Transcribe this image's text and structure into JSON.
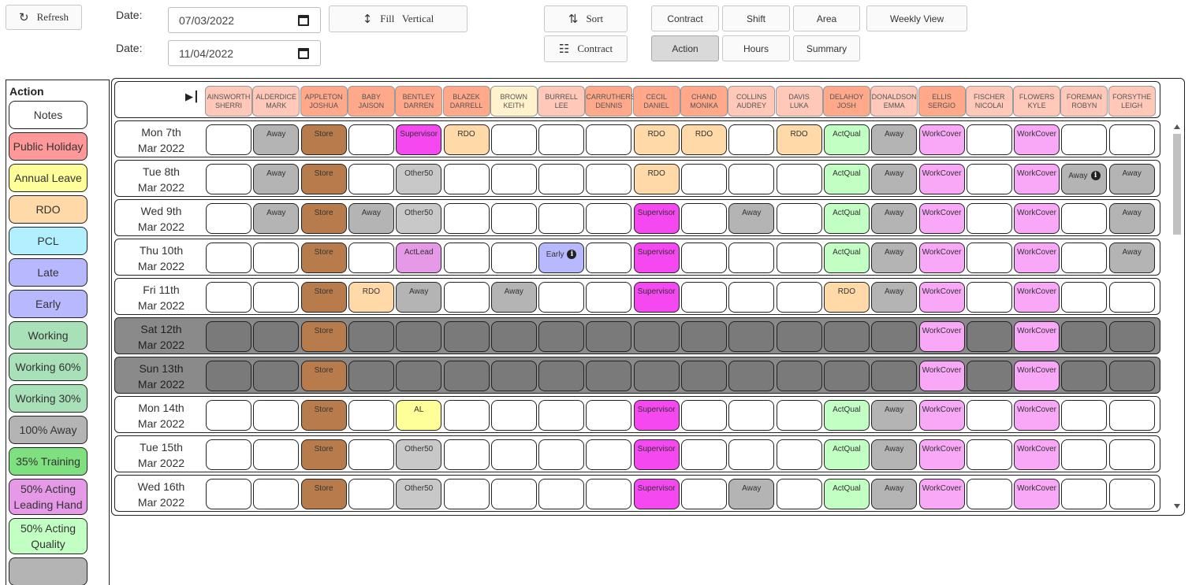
{
  "toolbar": {
    "refresh_label": "Refresh",
    "date_label_1": "Date:",
    "date_value_1": "07/03/2022",
    "date_label_2": "Date:",
    "date_value_2": "11/04/2022",
    "fill_label": "Fill   Vertical",
    "sort_label": "Sort",
    "contract_label": "Contract"
  },
  "tabs": [
    {
      "label": "Contract",
      "active": false
    },
    {
      "label": "Shift",
      "active": false
    },
    {
      "label": "Area",
      "active": false
    },
    {
      "label": "Weekly View",
      "active": false
    },
    {
      "label": "Action",
      "active": true
    },
    {
      "label": "Hours",
      "active": false
    },
    {
      "label": "Summary",
      "active": false
    }
  ],
  "sidebar": {
    "title": "Action",
    "items": [
      {
        "label": "Notes",
        "color": "#ffffff"
      },
      {
        "label": "Public Holiday",
        "color": "#ff9999"
      },
      {
        "label": "Annual Leave",
        "color": "#ffff99"
      },
      {
        "label": "RDO",
        "color": "#ffd9a8"
      },
      {
        "label": "PCL",
        "color": "#b3f0ff"
      },
      {
        "label": "Late",
        "color": "#b8b8ff"
      },
      {
        "label": "Early",
        "color": "#b8b8ff"
      },
      {
        "label": "Working",
        "color": "#a8e0b8"
      },
      {
        "label": "Working 60%",
        "color": "#a8e0b8"
      },
      {
        "label": "Working 30%",
        "color": "#a8e0b8"
      },
      {
        "label": "100% Away",
        "color": "#b4b4b4"
      },
      {
        "label": "35% Training",
        "color": "#7ee07e"
      },
      {
        "label": "50% Acting Leading Hand",
        "color": "#e699e6"
      },
      {
        "label": "50% Acting Quality",
        "color": "#c2ffc2"
      },
      {
        "label": "",
        "color": "#b4b4b4"
      }
    ]
  },
  "staff": [
    {
      "last": "AINSWORTH",
      "first": "SHERRI",
      "color": "#ffc8b8"
    },
    {
      "last": "ALDERDICE",
      "first": "MARK",
      "color": "#ffc8b8"
    },
    {
      "last": "APPLETON",
      "first": "JOSHUA",
      "color": "#ffa88a"
    },
    {
      "last": "BABY",
      "first": "JAISON",
      "color": "#ffa88a"
    },
    {
      "last": "BENTLEY",
      "first": "DARREN",
      "color": "#ffa88a"
    },
    {
      "last": "BLAZEK",
      "first": "DARRELL",
      "color": "#ffa88a"
    },
    {
      "last": "BROWN",
      "first": "KEITH",
      "color": "#fff2cc"
    },
    {
      "last": "BURRELL",
      "first": "LEE",
      "color": "#ffc8b8"
    },
    {
      "last": "CARRUTHERS",
      "first": "DENNIS",
      "color": "#ffa88a"
    },
    {
      "last": "CECIL",
      "first": "DANIEL",
      "color": "#ffa88a"
    },
    {
      "last": "CHAND",
      "first": "MONIKA",
      "color": "#ffa88a"
    },
    {
      "last": "COLLINS",
      "first": "AUDREY",
      "color": "#ffc8b8"
    },
    {
      "last": "DAVIS",
      "first": "LUKA",
      "color": "#ffc8b8"
    },
    {
      "last": "DELAHOY",
      "first": "JOSH",
      "color": "#ffa88a"
    },
    {
      "last": "DONALDSON",
      "first": "EMMA",
      "color": "#ffc8b8"
    },
    {
      "last": "ELLIS",
      "first": "SERGIO",
      "color": "#ffa88a"
    },
    {
      "last": "FISCHER",
      "first": "NICOLAI",
      "color": "#ffc8b8"
    },
    {
      "last": "FLOWERS",
      "first": "KYLE",
      "color": "#ffc8b8"
    },
    {
      "last": "FOREMAN",
      "first": "ROBYN",
      "color": "#ffc8b8"
    },
    {
      "last": "FORSYTHE",
      "first": "LEIGH",
      "color": "#ffc8b8"
    }
  ],
  "rows": [
    {
      "day": "Mon 7th",
      "month": "Mar 2022",
      "weekend": false,
      "cells": [
        "",
        "Away",
        "Store",
        "",
        "Supervisor",
        "RDO",
        "",
        "",
        "",
        "RDO",
        "RDO",
        "",
        "RDO",
        "ActQual",
        "Away",
        "WorkCover",
        "",
        "WorkCover",
        "",
        ""
      ]
    },
    {
      "day": "Tue 8th",
      "month": "Mar 2022",
      "weekend": false,
      "cells": [
        "",
        "Away",
        "Store",
        "",
        "Other50",
        "",
        "",
        "",
        "",
        "RDO",
        "",
        "",
        "",
        "ActQual",
        "Away",
        "WorkCover",
        "",
        "WorkCover",
        "Away*",
        "Away"
      ]
    },
    {
      "day": "Wed 9th",
      "month": "Mar 2022",
      "weekend": false,
      "cells": [
        "",
        "Away",
        "Store",
        "Away",
        "Other50",
        "",
        "",
        "",
        "",
        "Supervisor",
        "",
        "Away",
        "",
        "ActQual",
        "Away",
        "WorkCover",
        "",
        "WorkCover",
        "",
        "Away"
      ]
    },
    {
      "day": "Thu 10th",
      "month": "Mar 2022",
      "weekend": false,
      "cells": [
        "",
        "",
        "Store",
        "",
        "ActLead",
        "",
        "",
        "Early*",
        "",
        "Supervisor",
        "",
        "",
        "",
        "ActQual",
        "Away",
        "WorkCover",
        "",
        "WorkCover",
        "",
        "Away"
      ]
    },
    {
      "day": "Fri 11th",
      "month": "Mar 2022",
      "weekend": false,
      "cells": [
        "",
        "",
        "Store",
        "RDO",
        "Away",
        "",
        "Away",
        "",
        "",
        "Supervisor",
        "",
        "",
        "",
        "RDO",
        "Away",
        "WorkCover",
        "",
        "WorkCover",
        "",
        ""
      ]
    },
    {
      "day": "Sat 12th",
      "month": "Mar 2022",
      "weekend": true,
      "cells": [
        "",
        "",
        "Store",
        "",
        "",
        "",
        "",
        "",
        "",
        "",
        "",
        "",
        "",
        "",
        "",
        "WorkCover",
        "",
        "WorkCover",
        "",
        ""
      ]
    },
    {
      "day": "Sun 13th",
      "month": "Mar 2022",
      "weekend": true,
      "cells": [
        "",
        "",
        "Store",
        "",
        "",
        "",
        "",
        "",
        "",
        "",
        "",
        "",
        "",
        "",
        "",
        "WorkCover",
        "",
        "WorkCover",
        "",
        ""
      ]
    },
    {
      "day": "Mon 14th",
      "month": "Mar 2022",
      "weekend": false,
      "cells": [
        "",
        "",
        "Store",
        "",
        "AL",
        "",
        "",
        "",
        "",
        "Supervisor",
        "",
        "",
        "",
        "ActQual",
        "Away",
        "WorkCover",
        "",
        "WorkCover",
        "",
        ""
      ]
    },
    {
      "day": "Tue 15th",
      "month": "Mar 2022",
      "weekend": false,
      "cells": [
        "",
        "",
        "Store",
        "",
        "Other50",
        "",
        "",
        "",
        "",
        "Supervisor",
        "",
        "",
        "",
        "ActQual",
        "Away",
        "WorkCover",
        "",
        "WorkCover",
        "",
        ""
      ]
    },
    {
      "day": "Wed 16th",
      "month": "Mar 2022",
      "weekend": false,
      "cells": [
        "",
        "",
        "Store",
        "",
        "Other50",
        "",
        "",
        "",
        "",
        "Supervisor",
        "",
        "Away",
        "",
        "ActQual",
        "Away",
        "WorkCover",
        "",
        "WorkCover",
        "",
        ""
      ]
    }
  ],
  "status_colors": {
    "Away": "#b4b4b4",
    "Store": "#b87c4c",
    "Supervisor": "#f548f0",
    "RDO": "#ffd9a8",
    "ActQual": "#c2ffc2",
    "WorkCover": "#f9a8f7",
    "Other50": "#c8c8c8",
    "ActLead": "#e699e6",
    "Early": "#b8b8ff",
    "AL": "#ffff99"
  }
}
